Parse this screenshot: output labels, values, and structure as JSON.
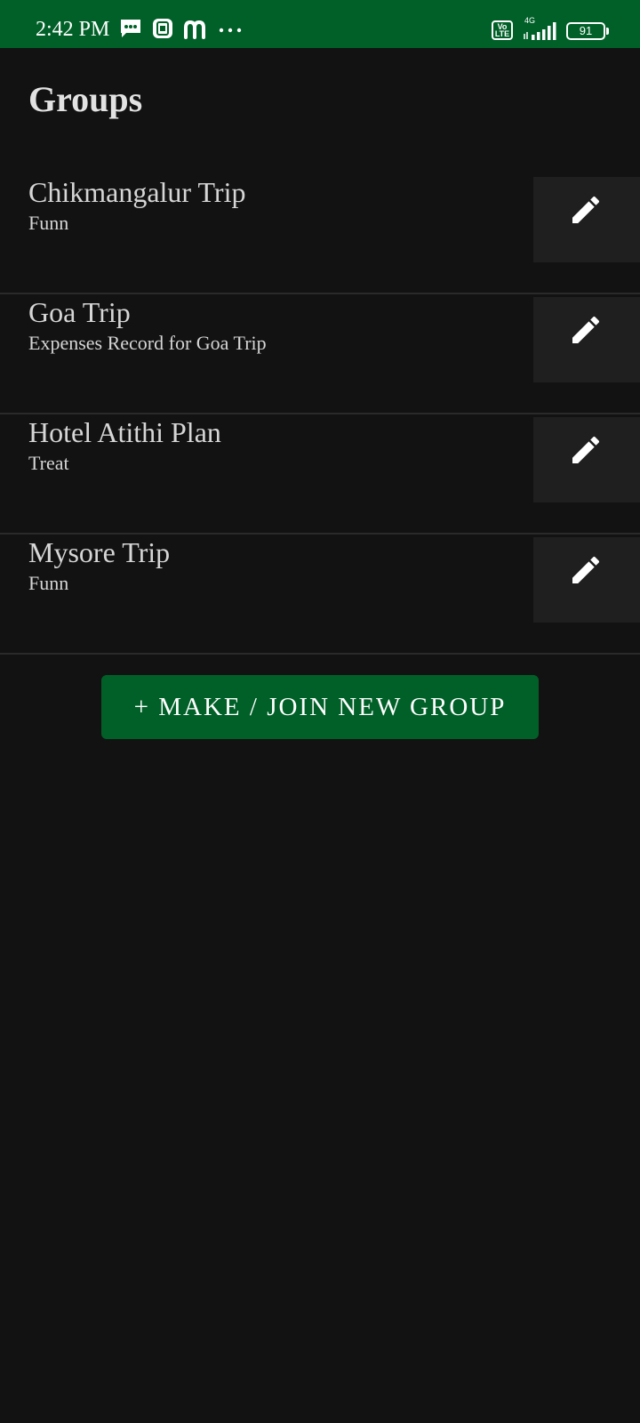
{
  "status_bar": {
    "time": "2:42 PM",
    "network_label": "4G",
    "volte_label": "Vo\nLTE",
    "battery_level": "91",
    "background_color": "#006028",
    "icons": [
      "message-icon",
      "app-icon",
      "m-icon",
      "more-dots-icon",
      "volte-icon",
      "signal-icon",
      "battery-icon"
    ]
  },
  "page": {
    "title": "Groups"
  },
  "groups": [
    {
      "name": "Chikmangalur Trip",
      "description": "Funn"
    },
    {
      "name": "Goa Trip",
      "description": "Expenses Record for Goa Trip"
    },
    {
      "name": "Hotel Atithi Plan",
      "description": "Treat"
    },
    {
      "name": "Mysore Trip",
      "description": "Funn"
    }
  ],
  "edit_icon": "pencil-icon",
  "actions": {
    "make_join_label": "+ MAKE / JOIN NEW GROUP",
    "accent_color": "#006028"
  },
  "theme": {
    "background": "#121212",
    "row_button_background": "#1f1f1f"
  }
}
